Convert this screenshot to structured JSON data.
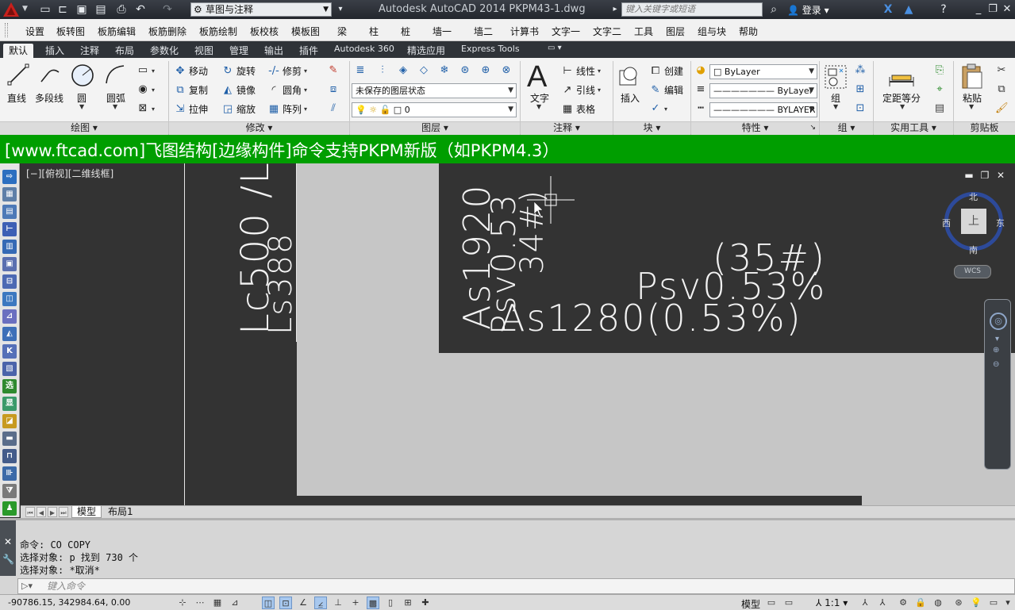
{
  "titlebar": {
    "workspace": "草图与注释",
    "title": "Autodesk AutoCAD 2014    PKPM43-1.dwg",
    "search_placeholder": "键入关键字或短语",
    "login": "登录"
  },
  "menubar": {
    "items": [
      "设置",
      "板转图",
      "板筋编辑",
      "板筋删除",
      "板筋绘制",
      "板校核",
      "模板图",
      "梁",
      "柱",
      "桩",
      "墙一",
      "墙二",
      "计算书",
      "文字一",
      "文字二",
      "工具",
      "图层",
      "组与块",
      "帮助"
    ]
  },
  "ribbon_tabs": [
    "默认",
    "插入",
    "注释",
    "布局",
    "参数化",
    "视图",
    "管理",
    "输出",
    "插件",
    "Autodesk 360",
    "精选应用",
    "Express Tools"
  ],
  "ribbon": {
    "draw": {
      "title": "绘图",
      "line": "直线",
      "polyline": "多段线",
      "circle": "圆",
      "arc": "圆弧"
    },
    "modify": {
      "title": "修改",
      "move": "移动",
      "rotate": "旋转",
      "trim": "修剪",
      "copy": "复制",
      "mirror": "镜像",
      "fillet": "圆角",
      "stretch": "拉伸",
      "scale": "缩放",
      "array": "阵列"
    },
    "layers": {
      "title": "图层",
      "state": "未保存的图层状态",
      "current": "0"
    },
    "annotation": {
      "title": "注释",
      "text": "文字",
      "linear": "线性",
      "leader": "引线",
      "table": "表格"
    },
    "block": {
      "title": "块",
      "insert": "插入",
      "create": "创建",
      "edit": "编辑"
    },
    "properties": {
      "title": "特性",
      "color": "ByLayer",
      "lineweight": "ByLayer",
      "linetype": "BYLAYER"
    },
    "groups": {
      "title": "组",
      "group": "组"
    },
    "utilities": {
      "title": "实用工具",
      "measure": "定距等分"
    },
    "clipboard": {
      "title": "剪贴板",
      "paste": "粘贴"
    }
  },
  "banner": {
    "text": "[www.ftcad.com]飞图结构[边缘构件]命令支持PKPM新版（如PKPM4.3）"
  },
  "drawing": {
    "view_label": "[−][俯视][二维线框]",
    "texts": {
      "lc": "Lc500 /L",
      "ls": "Ls388",
      "as1920": "As1920",
      "psv053": "Psv0.53",
      "num34": "34#)",
      "num35": "(35#)",
      "psv053pct": "Psv0.53%",
      "as1280": "As1280(0.53%)"
    },
    "compass": {
      "north": "北",
      "south": "南",
      "east": "东",
      "west": "西",
      "top": "上"
    },
    "wcs": "WCS"
  },
  "layout_tabs": [
    "模型",
    "布局1"
  ],
  "command": {
    "history": [
      "命令: CO COPY",
      "选择对象: p 找到 730 个",
      "选择对象: *取消*"
    ],
    "placeholder": "键入命令"
  },
  "statusbar": {
    "coords": "-90786.15, 342984.64, 0.00",
    "model": "模型",
    "scale": "1:1"
  },
  "colors": {
    "banner": "#009e00",
    "canvas": "#333333",
    "paper": "#c6c6c6",
    "viewcube_ring": "#2d4a9a"
  }
}
